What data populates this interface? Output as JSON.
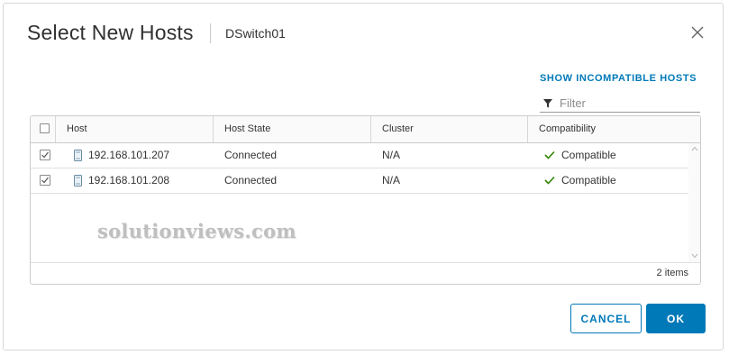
{
  "dialog": {
    "title": "Select New Hosts",
    "subtitle": "DSwitch01",
    "close_icon": "close-icon"
  },
  "toolbar": {
    "show_incompatible_label": "SHOW INCOMPATIBLE HOSTS",
    "filter_placeholder": "Filter",
    "filter_value": "",
    "filter_icon": "funnel-icon"
  },
  "grid": {
    "columns": [
      "Host",
      "Host State",
      "Cluster",
      "Compatibility"
    ],
    "select_all_checked": false,
    "rows": [
      {
        "checked": true,
        "host": "192.168.101.207",
        "host_icon": "host-icon",
        "state": "Connected",
        "cluster": "N/A",
        "compatibility": "Compatible",
        "compatibility_icon": "checkmark-icon"
      },
      {
        "checked": true,
        "host": "192.168.101.208",
        "host_icon": "host-icon",
        "state": "Connected",
        "cluster": "N/A",
        "compatibility": "Compatible",
        "compatibility_icon": "checkmark-icon"
      }
    ],
    "footer_count": "2 items"
  },
  "watermark": "solutionviews.com",
  "buttons": {
    "cancel_label": "CANCEL",
    "ok_label": "OK"
  },
  "colors": {
    "accent": "#0079b8",
    "success": "#2f8400",
    "border": "#cccccc"
  }
}
